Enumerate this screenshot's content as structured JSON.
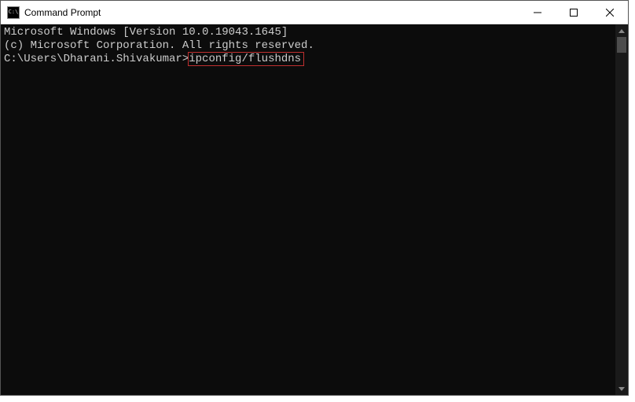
{
  "window": {
    "title": "Command Prompt"
  },
  "terminal": {
    "line1": "Microsoft Windows [Version 10.0.19043.1645]",
    "line2": "(c) Microsoft Corporation. All rights reserved.",
    "blank": "",
    "prompt": "C:\\Users\\Dharani.Shivakumar>",
    "command": "ipconfig/flushdns"
  },
  "colors": {
    "terminal_bg": "#0c0c0c",
    "terminal_fg": "#cccccc",
    "highlight_border": "#c03030"
  }
}
